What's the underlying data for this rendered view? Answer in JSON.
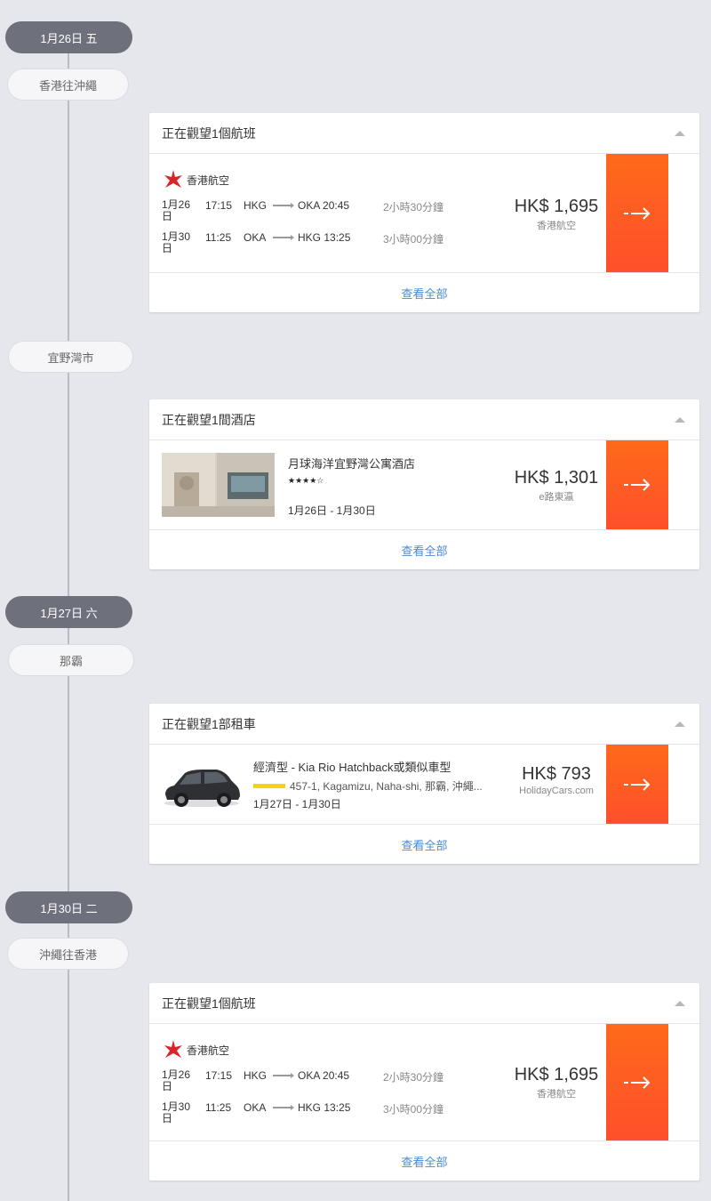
{
  "timeline": [
    {
      "date": "1月26日 五",
      "place": "香港往沖繩"
    },
    {
      "place": "宜野灣市"
    },
    {
      "date": "1月27日 六",
      "place": "那霸"
    },
    {
      "date": "1月30日 二",
      "place": "沖繩往香港"
    }
  ],
  "common": {
    "view_all": "查看全部"
  },
  "flight1": {
    "header": "正在觀望1個航班",
    "airline": "香港航空",
    "legs": [
      {
        "date": "1月26日",
        "dep_time": "17:15",
        "origin": "HKG",
        "dest": "OKA",
        "arr_time": "20:45",
        "duration": "2小時30分鐘"
      },
      {
        "date": "1月30日",
        "dep_time": "11:25",
        "origin": "OKA",
        "dest": "HKG",
        "arr_time": "13:25",
        "duration": "3小時00分鐘"
      }
    ],
    "price": "HK$ 1,695",
    "provider": "香港航空"
  },
  "hotel": {
    "header": "正在觀望1間酒店",
    "name": "月球海洋宜野灣公寓酒店",
    "stars": "★★★★☆",
    "dates": "1月26日 - 1月30日",
    "price": "HK$ 1,301",
    "provider": "e路東瀛"
  },
  "car": {
    "header": "正在觀望1部租車",
    "name": "經濟型 - Kia Rio Hatchback或類似車型",
    "address": "457-1, Kagamizu, Naha-shi, 那霸, 沖繩...",
    "dates": "1月27日 - 1月30日",
    "price": "HK$ 793",
    "provider": "HolidayCars.com"
  },
  "flight2": {
    "header": "正在觀望1個航班",
    "airline": "香港航空",
    "legs": [
      {
        "date": "1月26日",
        "dep_time": "17:15",
        "origin": "HKG",
        "dest": "OKA",
        "arr_time": "20:45",
        "duration": "2小時30分鐘"
      },
      {
        "date": "1月30日",
        "dep_time": "11:25",
        "origin": "OKA",
        "dest": "HKG",
        "arr_time": "13:25",
        "duration": "3小時00分鐘"
      }
    ],
    "price": "HK$ 1,695",
    "provider": "香港航空"
  },
  "colors": {
    "accent_orange": "#ff5a22",
    "link_blue": "#4a8ad4",
    "pill_dark": "#6e717b",
    "background": "#e6e7ec"
  }
}
